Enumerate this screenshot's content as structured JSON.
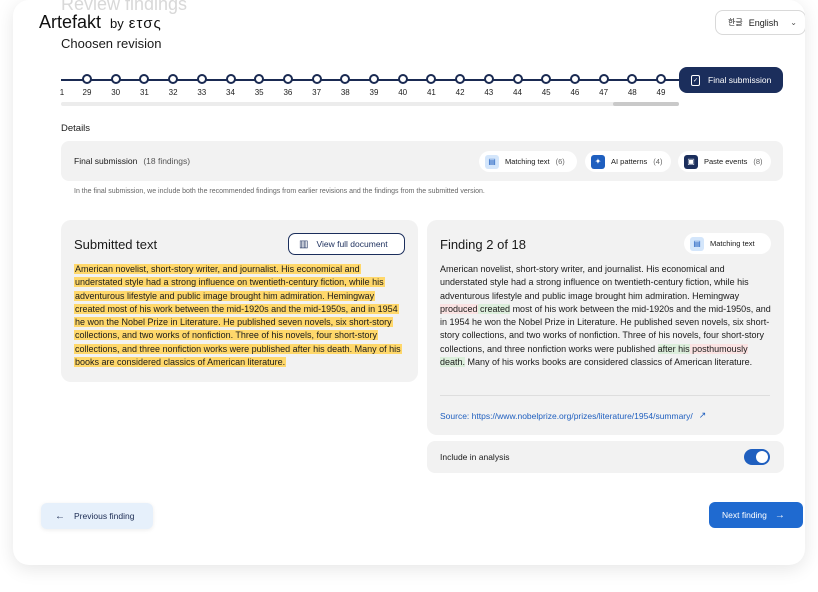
{
  "header": {
    "ghost_title": "Review findings",
    "logo_brand": "Artefakt",
    "logo_by": "by",
    "logo_org": "ετσς",
    "language": {
      "icon": "한글",
      "label": "English"
    }
  },
  "revision": {
    "title": "Choosen revision",
    "timeline_labels": [
      "1",
      "29",
      "30",
      "31",
      "32",
      "33",
      "34",
      "35",
      "36",
      "37",
      "38",
      "39",
      "40",
      "41",
      "42",
      "43",
      "44",
      "45",
      "46",
      "47",
      "48",
      "49"
    ],
    "final_label": "Final submission"
  },
  "details": {
    "label": "Details",
    "summary_title": "Final submission",
    "summary_count": "(18 findings)",
    "chips": [
      {
        "label": "Matching text",
        "count": "(6)",
        "icon": "document-icon"
      },
      {
        "label": "AI patterns",
        "count": "(4)",
        "icon": "sparkle-icon"
      },
      {
        "label": "Paste events",
        "count": "(8)",
        "icon": "clipboard-icon"
      }
    ],
    "note": "In the final submission, we include both the recommended findings from earlier revisions and the findings from the submitted version."
  },
  "submitted": {
    "title": "Submitted text",
    "view_button": "View full document",
    "text": "American novelist, short-story writer, and journalist. His economical and understated style had a strong influence on twentieth-century fiction, while his adventurous lifestyle and public image brought him admiration. Hemingway created most of his work between the mid-1920s and the mid-1950s, and in 1954 he won the Nobel Prize in Literature. He published seven novels, six short-story collections, and two works of nonfiction. Three of his novels, four short-story collections, and three nonfiction works were published after his death. Many of his books are considered classics of American literature."
  },
  "finding": {
    "title": "Finding 2 of 18",
    "chip": "Matching text",
    "seg1": "American novelist, short-story writer, and journalist. His economical  and understated style had a strong influence on twentieth-century  fiction, while his adventurous lifestyle and public image brought him  admiration. Hemingway ",
    "seg_red1": "produced",
    "seg_green1": " created",
    "seg2": " most of his work between the mid-1920s and the mid-1950s, and in 1954  he won the Nobel Prize in Literature. He published seven novels, six short-story collections, and two works of nonfiction. Three of his  novels, four short-story collections, and three nonfiction works were  published ",
    "seg_green2": "after his",
    "seg_red2": " posthumously",
    "seg_green3": " death.",
    "seg3": " Many of his works books are considered classics of American literature.",
    "source": "Source: https://www.nobelprize.org/prizes/literature/1954/summary/"
  },
  "include": {
    "label": "Include in analysis",
    "enabled": true
  },
  "nav": {
    "prev": "Previous finding",
    "next": "Next finding"
  },
  "colors": {
    "navy": "#1b2e5c",
    "blue": "#1f6ad0",
    "highlight": "#ffd86b"
  }
}
